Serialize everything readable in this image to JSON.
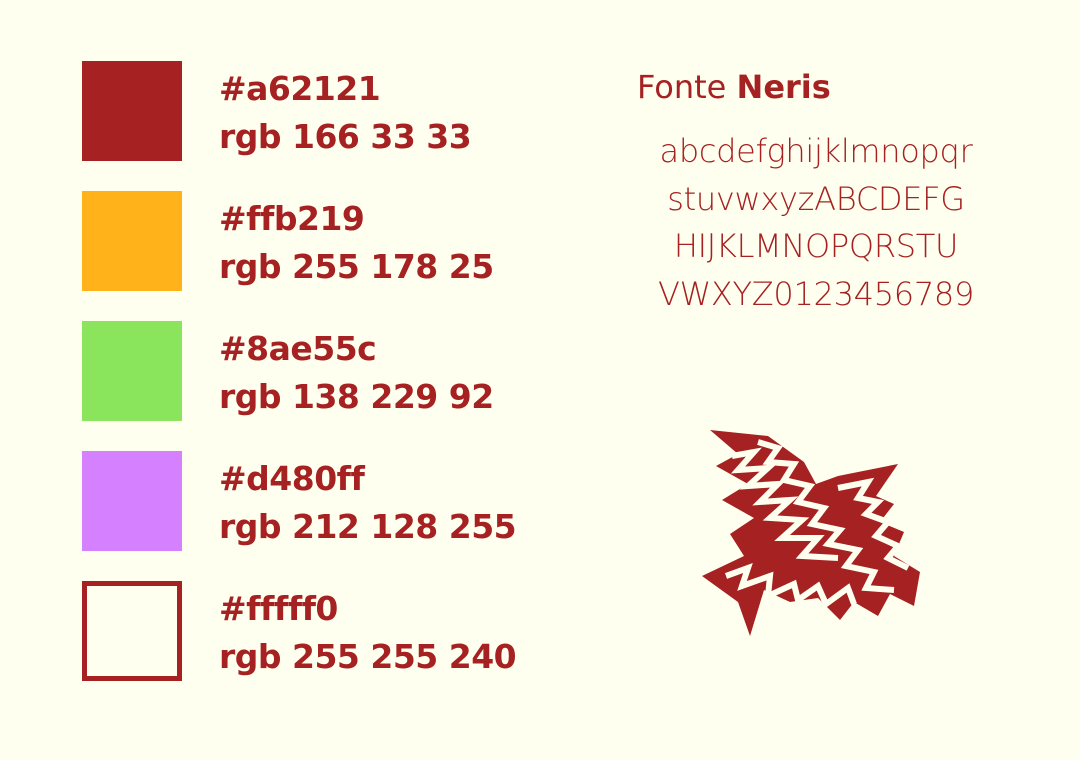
{
  "palette": [
    {
      "hex": "#a62121",
      "rgb": "rgb 166 33 33",
      "color": "#a62121"
    },
    {
      "hex": "#ffb219",
      "rgb": "rgb 255 178 25",
      "color": "#ffb219"
    },
    {
      "hex": "#8ae55c",
      "rgb": "rgb 138 229 92",
      "color": "#8ae55c"
    },
    {
      "hex": "#d480ff",
      "rgb": "rgb 212 128 255",
      "color": "#d480ff"
    },
    {
      "hex": "#fffff0",
      "rgb": "rgb 255 255 240",
      "color": "#fffff0"
    }
  ],
  "font": {
    "prefix": "Fonte",
    "name": "Neris",
    "specimen": [
      "abcdefghijklmnopqr",
      "stuvwxyzABCDEFG",
      "HIJKLMNOPQRSTU",
      "VWXYZ0123456789"
    ]
  },
  "colors": {
    "background": "#fffff0",
    "accent": "#a62121"
  },
  "logo": {
    "icon": "bird-logo-icon"
  }
}
